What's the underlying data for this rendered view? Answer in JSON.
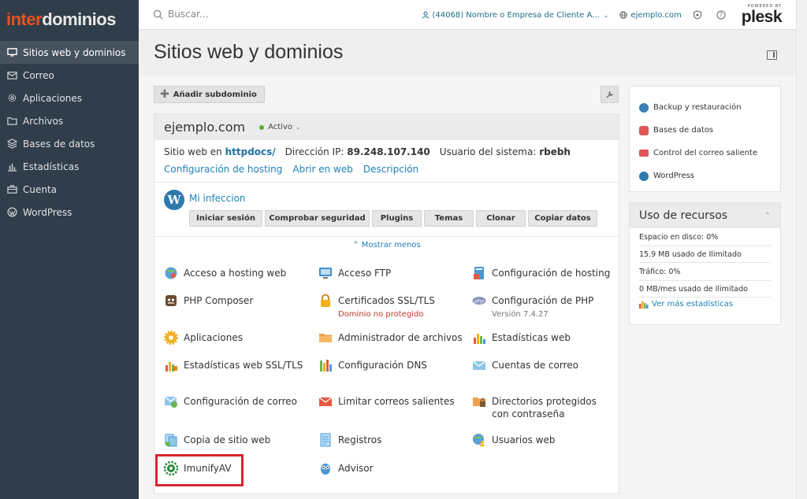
{
  "brand": {
    "logo_part1": "inter",
    "logo_part2": "dominios",
    "accent": "#e8541c"
  },
  "sidebar": {
    "items": [
      {
        "label": "Sitios web y dominios",
        "icon": "monitor-icon",
        "active": true
      },
      {
        "label": "Correo",
        "icon": "mail-icon"
      },
      {
        "label": "Aplicaciones",
        "icon": "gear-icon"
      },
      {
        "label": "Archivos",
        "icon": "folder-icon"
      },
      {
        "label": "Bases de datos",
        "icon": "database-icon"
      },
      {
        "label": "Estadísticas",
        "icon": "bar-chart-icon"
      },
      {
        "label": "Cuenta",
        "icon": "briefcase-icon"
      },
      {
        "label": "WordPress",
        "icon": "wordpress-icon"
      }
    ]
  },
  "topbar": {
    "search_placeholder": "Buscar...",
    "customer": "(44068) Nombre o Empresa de Cliente A...",
    "domain": "ejemplo.com",
    "powered_by": "POWERED BY",
    "plesk": "plesk"
  },
  "page": {
    "title": "Sitios web y dominios"
  },
  "toolbar": {
    "add_subdomain": "Añadir subdominio"
  },
  "domain_card": {
    "name": "ejemplo.com",
    "status": "Activo",
    "site_prefix": "Sitio web en",
    "site_dir": "httpdocs/",
    "ip_label": "Dirección IP:",
    "ip": "89.248.107.140",
    "user_label": "Usuario del sistema:",
    "user": "rbebh",
    "links": [
      "Configuración de hosting",
      "Abrir en web",
      "Descripción"
    ],
    "wp_site": "Mi infeccion",
    "wp_buttons": [
      "Iniciar sesión",
      "Comprobar seguridad",
      "Plugins",
      "Temas",
      "Clonar",
      "Copiar datos"
    ],
    "show_less": "Mostrar menos"
  },
  "tools": [
    {
      "label": "Acceso a hosting web",
      "icon": "globe-user-icon"
    },
    {
      "label": "Acceso FTP",
      "icon": "ftp-monitor-icon"
    },
    {
      "label": "Configuración de hosting",
      "icon": "hosting-config-icon"
    },
    {
      "label": "PHP Composer",
      "icon": "composer-icon"
    },
    {
      "label": "Certificados SSL/TLS",
      "icon": "lock-icon",
      "sub": "Dominio no protegido"
    },
    {
      "label": "Configuración de PHP",
      "icon": "php-icon",
      "sub": "Versión 7.4.27"
    },
    {
      "label": "Aplicaciones",
      "icon": "gear-apps-icon"
    },
    {
      "label": "Administrador de archivos",
      "icon": "file-manager-icon"
    },
    {
      "label": "Estadísticas web",
      "icon": "web-stats-icon"
    },
    {
      "label": "Estadísticas web SSL/TLS",
      "icon": "ssl-stats-icon"
    },
    {
      "label": "Configuración DNS",
      "icon": "dns-icon"
    },
    {
      "label": "Cuentas de correo",
      "icon": "mail-accounts-icon"
    },
    {
      "label": "Configuración de correo",
      "icon": "mail-settings-icon"
    },
    {
      "label": "Limitar correos salientes",
      "icon": "outgoing-mail-icon"
    },
    {
      "label": "Directorios protegidos con contraseña",
      "icon": "protected-dir-icon"
    },
    {
      "label": "Copia de sitio web",
      "icon": "site-copy-icon"
    },
    {
      "label": "Registros",
      "icon": "logs-icon"
    },
    {
      "label": "Usuarios web",
      "icon": "web-users-icon"
    },
    {
      "label": "ImunifyAV",
      "icon": "imunify-icon"
    },
    {
      "label": "Advisor",
      "icon": "advisor-owl-icon"
    }
  ],
  "right_links": [
    {
      "label": "Backup y restauración",
      "color": "#3b7fb5"
    },
    {
      "label": "Bases de datos",
      "color": "#e05656"
    },
    {
      "label": "Control del correo saliente",
      "color": "#e05656"
    },
    {
      "label": "WordPress",
      "color": "#2e7aad"
    }
  ],
  "resources": {
    "title": "Uso de recursos",
    "disk_label": "Espacio en disco: 0%",
    "disk_detail": "15.9 MB usado de Ilimitado",
    "traffic_label": "Tráfico: 0%",
    "traffic_detail": "0 MB/mes usado de Ilimitado",
    "more": "Ver más estadísticas"
  }
}
